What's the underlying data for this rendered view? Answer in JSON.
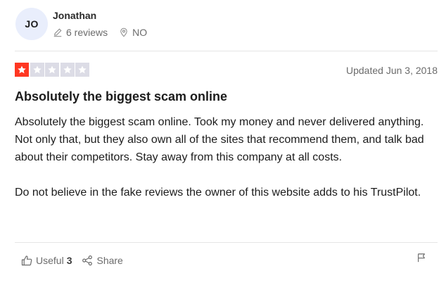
{
  "author": {
    "initials": "JO",
    "name": "Jonathan",
    "reviews_count": "6 reviews",
    "location": "NO"
  },
  "rating": {
    "value": 1,
    "max": 5,
    "filled_color": "#ff3722",
    "empty_color": "#dcdce6"
  },
  "review": {
    "date": "Updated Jun 3, 2018",
    "title": "Absolutely the biggest scam online",
    "paragraphs": [
      "Absolutely the biggest scam online. Took my money and never delivered anything. Not only that, but they also own all of the sites that recommend them, and talk bad about their competitors. Stay away from this company at all costs.",
      "Do not believe in the fake reviews the owner of this website adds to his TrustPilot."
    ]
  },
  "actions": {
    "useful_label": "Useful",
    "useful_count": "3",
    "share_label": "Share",
    "icons": [
      "thumbs-up-icon",
      "share-icon",
      "flag-icon"
    ]
  }
}
